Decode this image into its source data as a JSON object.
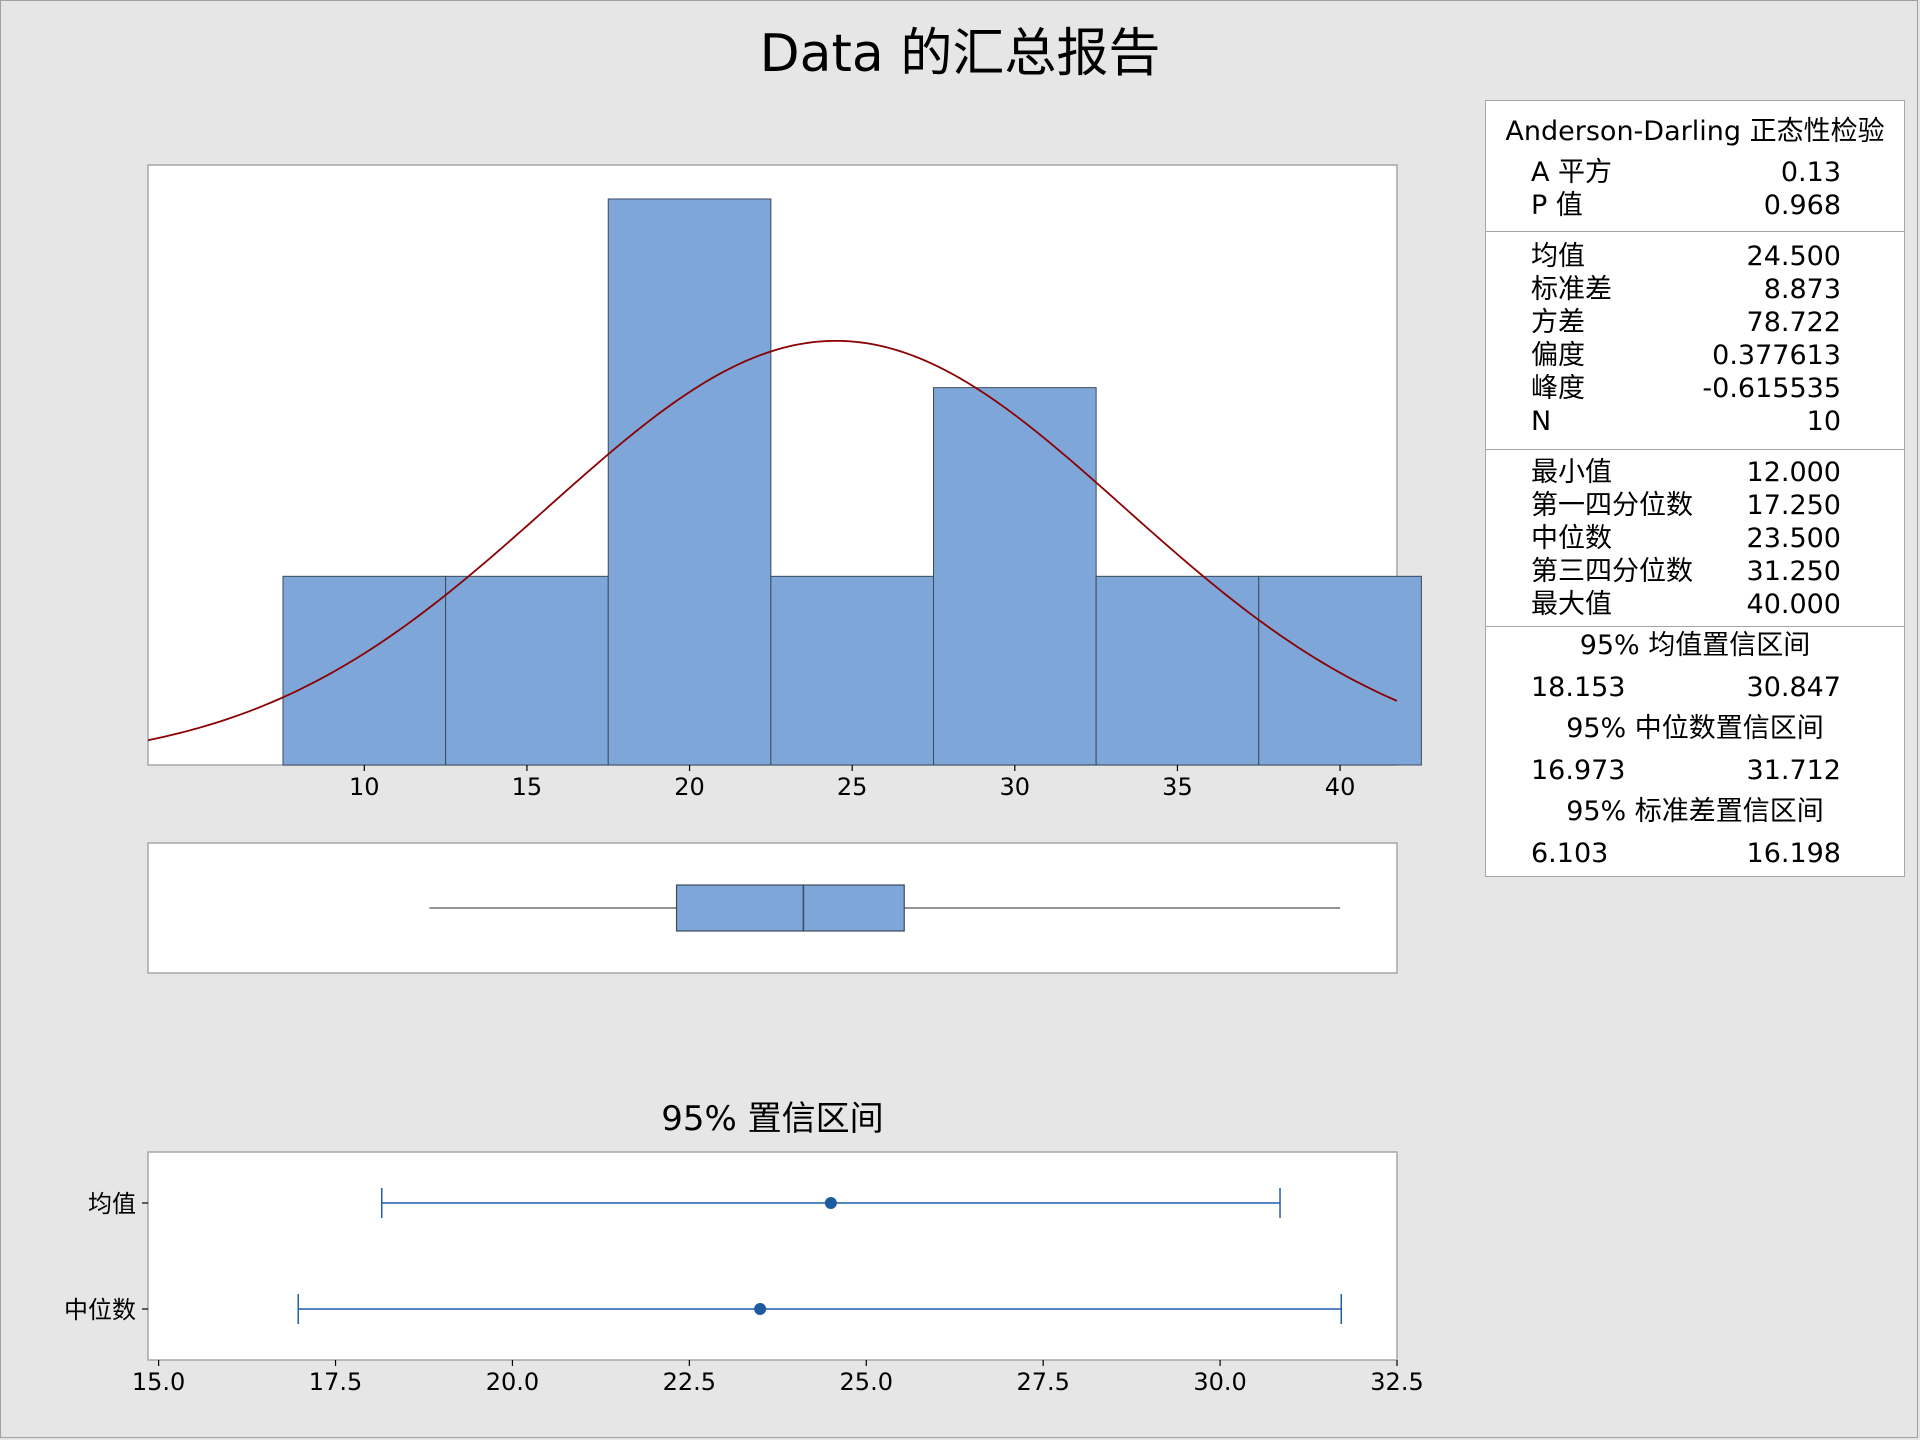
{
  "title": "Data 的汇总报告",
  "stats_panel": {
    "ad_title": "Anderson-Darling 正态性检验",
    "ad_rows": [
      {
        "label": "A 平方",
        "value": "0.13"
      },
      {
        "label": "P 值",
        "value": "0.968"
      }
    ],
    "moment_rows": [
      {
        "label": "均值",
        "value": "24.500"
      },
      {
        "label": "标准差",
        "value": "8.873"
      },
      {
        "label": "方差",
        "value": "78.722"
      },
      {
        "label": "偏度",
        "value": "0.377613"
      },
      {
        "label": "峰度",
        "value": "-0.615535"
      },
      {
        "label": "N",
        "value": "10"
      }
    ],
    "quantile_rows": [
      {
        "label": "最小值",
        "value": "12.000"
      },
      {
        "label": "第一四分位数",
        "value": "17.250"
      },
      {
        "label": "中位数",
        "value": "23.500"
      },
      {
        "label": "第三四分位数",
        "value": "31.250"
      },
      {
        "label": "最大值",
        "value": "40.000"
      }
    ],
    "ci_blocks": [
      {
        "title": "95% 均值置信区间",
        "low": "18.153",
        "high": "30.847"
      },
      {
        "title": "95% 中位数置信区间",
        "low": "16.973",
        "high": "31.712"
      },
      {
        "title": "95% 标准差置信区间",
        "low": "6.103",
        "high": "16.198"
      }
    ]
  },
  "chart_data": [
    {
      "type": "bar",
      "subtype": "histogram",
      "bin_edges": [
        7.5,
        12.5,
        17.5,
        22.5,
        27.5,
        32.5,
        37.5,
        42.5
      ],
      "counts": [
        1,
        1,
        3,
        1,
        2,
        1,
        1
      ],
      "xlim": [
        3.35,
        41.75
      ],
      "ylim": [
        0,
        3.18
      ],
      "xticks": [
        10,
        15,
        20,
        25,
        30,
        35,
        40
      ],
      "xtick_labels": [
        "10",
        "15",
        "20",
        "25",
        "30",
        "35",
        "40"
      ],
      "fit_curve": {
        "type": "normal",
        "mean": 24.5,
        "sd": 8.873,
        "n": 10,
        "bin_width": 5
      },
      "colors": {
        "bar": "#7ea6d9",
        "curve": "#8b0000"
      }
    },
    {
      "type": "boxplot",
      "xlim": [
        3.35,
        41.75
      ],
      "min": 12.0,
      "q1": 19.6,
      "median": 23.5,
      "q3": 26.6,
      "max": 40.0,
      "colors": {
        "box": "#7ea6d9"
      }
    },
    {
      "type": "interval",
      "title": "95% 置信区间",
      "xlim": [
        14.85,
        32.5
      ],
      "xticks": [
        15.0,
        17.5,
        20.0,
        22.5,
        25.0,
        27.5,
        30.0,
        32.5
      ],
      "xtick_labels": [
        "15.0",
        "17.5",
        "20.0",
        "22.5",
        "25.0",
        "27.5",
        "30.0",
        "32.5"
      ],
      "intervals": [
        {
          "label": "均值",
          "estimate": 24.5,
          "low": 18.153,
          "high": 30.847
        },
        {
          "label": "中位数",
          "estimate": 23.5,
          "low": 16.973,
          "high": 31.712
        }
      ],
      "colors": {
        "line": "#1f5fa8",
        "dot": "#1e5aa0"
      }
    }
  ]
}
